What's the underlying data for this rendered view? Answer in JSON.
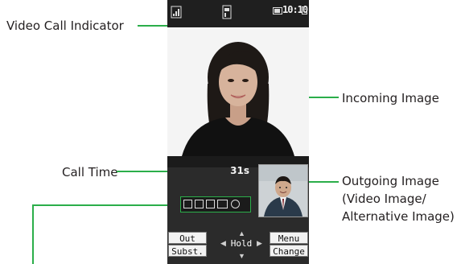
{
  "callouts": {
    "video_call_indicator": "Video Call Indicator",
    "incoming_image": "Incoming Image",
    "call_time": "Call Time",
    "outgoing_image_line1": "Outgoing Image",
    "outgoing_image_line2": "(Video Image/",
    "outgoing_image_line3": "Alternative Image)"
  },
  "screen": {
    "clock": "10:10",
    "call_time": "31s",
    "softkeys": {
      "left_top": "Out cam",
      "left_bottom": "Subst.",
      "center": "Hold",
      "right_top": "Menu",
      "right_bottom": "Change"
    }
  },
  "icons": {
    "signal": "signal-strength-icon",
    "video_call": "video-call-indicator-icon",
    "battery": "battery-icon",
    "status_row": [
      "mic-icon",
      "video-icon",
      "camera-icon",
      "speaker-icon",
      "record-icon"
    ]
  },
  "colors": {
    "callout_line": "#2bae4a",
    "screen_bg": "#2b2b2b"
  }
}
